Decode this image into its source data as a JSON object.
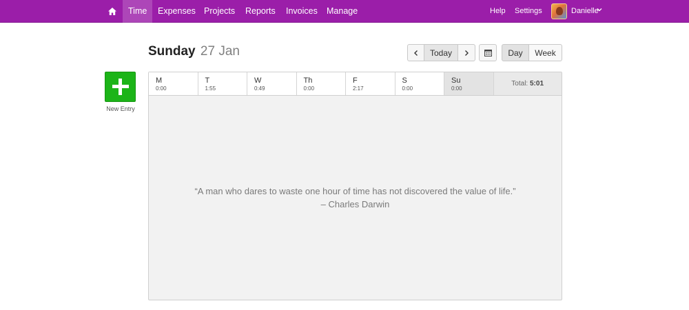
{
  "nav": {
    "home_icon": "home-icon",
    "items": [
      "Time",
      "Expenses",
      "Projects",
      "Reports",
      "Invoices",
      "Manage"
    ],
    "active": "Time",
    "help": "Help",
    "settings": "Settings",
    "user": "Danielle",
    "user_chevron": "⌄",
    "brand_color": "#9b1ea9"
  },
  "header": {
    "day": "Sunday",
    "date": "27 Jan"
  },
  "controls": {
    "prev_icon": "<",
    "today": "Today",
    "next_icon": ">",
    "calendar_icon": "calendar-icon",
    "day": "Day",
    "week": "Week"
  },
  "new_entry": {
    "label": "New Entry",
    "color": "#1cb418"
  },
  "week": {
    "days": [
      {
        "name": "M",
        "time": "0:00"
      },
      {
        "name": "T",
        "time": "1:55"
      },
      {
        "name": "W",
        "time": "0:49"
      },
      {
        "name": "Th",
        "time": "0:00"
      },
      {
        "name": "F",
        "time": "2:17"
      },
      {
        "name": "S",
        "time": "0:00"
      },
      {
        "name": "Su",
        "time": "0:00"
      }
    ],
    "selected": "Su",
    "total_label": "Total:",
    "total_value": "5:01"
  },
  "quote": {
    "text": "“A man who dares to waste one hour of time has not discovered the value of life.”",
    "author": "– Charles Darwin"
  }
}
